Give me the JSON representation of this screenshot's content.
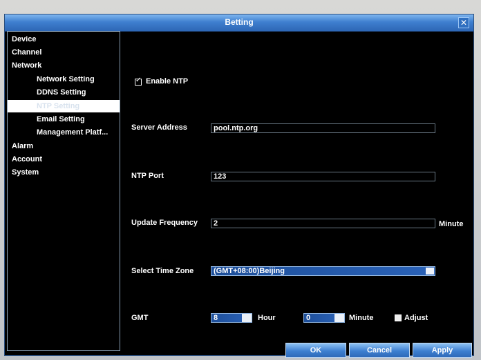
{
  "window": {
    "title": "Betting"
  },
  "sidebar": {
    "items": [
      {
        "label": "Device",
        "level": 0
      },
      {
        "label": "Channel",
        "level": 0
      },
      {
        "label": "Network",
        "level": 0
      },
      {
        "label": "Network Setting",
        "level": 1
      },
      {
        "label": "DDNS Setting",
        "level": 1
      },
      {
        "label": "NTP Setting",
        "level": 1,
        "selected": true
      },
      {
        "label": "Email Setting",
        "level": 1
      },
      {
        "label": "Management Platf...",
        "level": 1
      },
      {
        "label": "Alarm",
        "level": 0
      },
      {
        "label": "Account",
        "level": 0
      },
      {
        "label": "System",
        "level": 0
      }
    ]
  },
  "ntp": {
    "enable_label": "Enable NTP",
    "enable_checked": true,
    "server_label": "Server Address",
    "server_value": "pool.ntp.org",
    "port_label": "NTP Port",
    "port_value": "123",
    "freq_label": "Update Frequency",
    "freq_value": "2",
    "freq_unit": "Minute",
    "tz_label": "Select Time Zone",
    "tz_value": "(GMT+08:00)Beijing",
    "gmt_label": "GMT",
    "gmt_hour_value": "8",
    "gmt_hour_unit": "Hour",
    "gmt_minute_value": "0",
    "gmt_minute_unit": "Minute",
    "adjust_label": "Adjust",
    "adjust_checked": false
  },
  "buttons": {
    "ok": "OK",
    "cancel": "Cancel",
    "apply": "Apply"
  },
  "colors": {
    "titlebar": "#3f7fcf",
    "selected": "#ffffff",
    "field_blue": "#2a62b8"
  }
}
